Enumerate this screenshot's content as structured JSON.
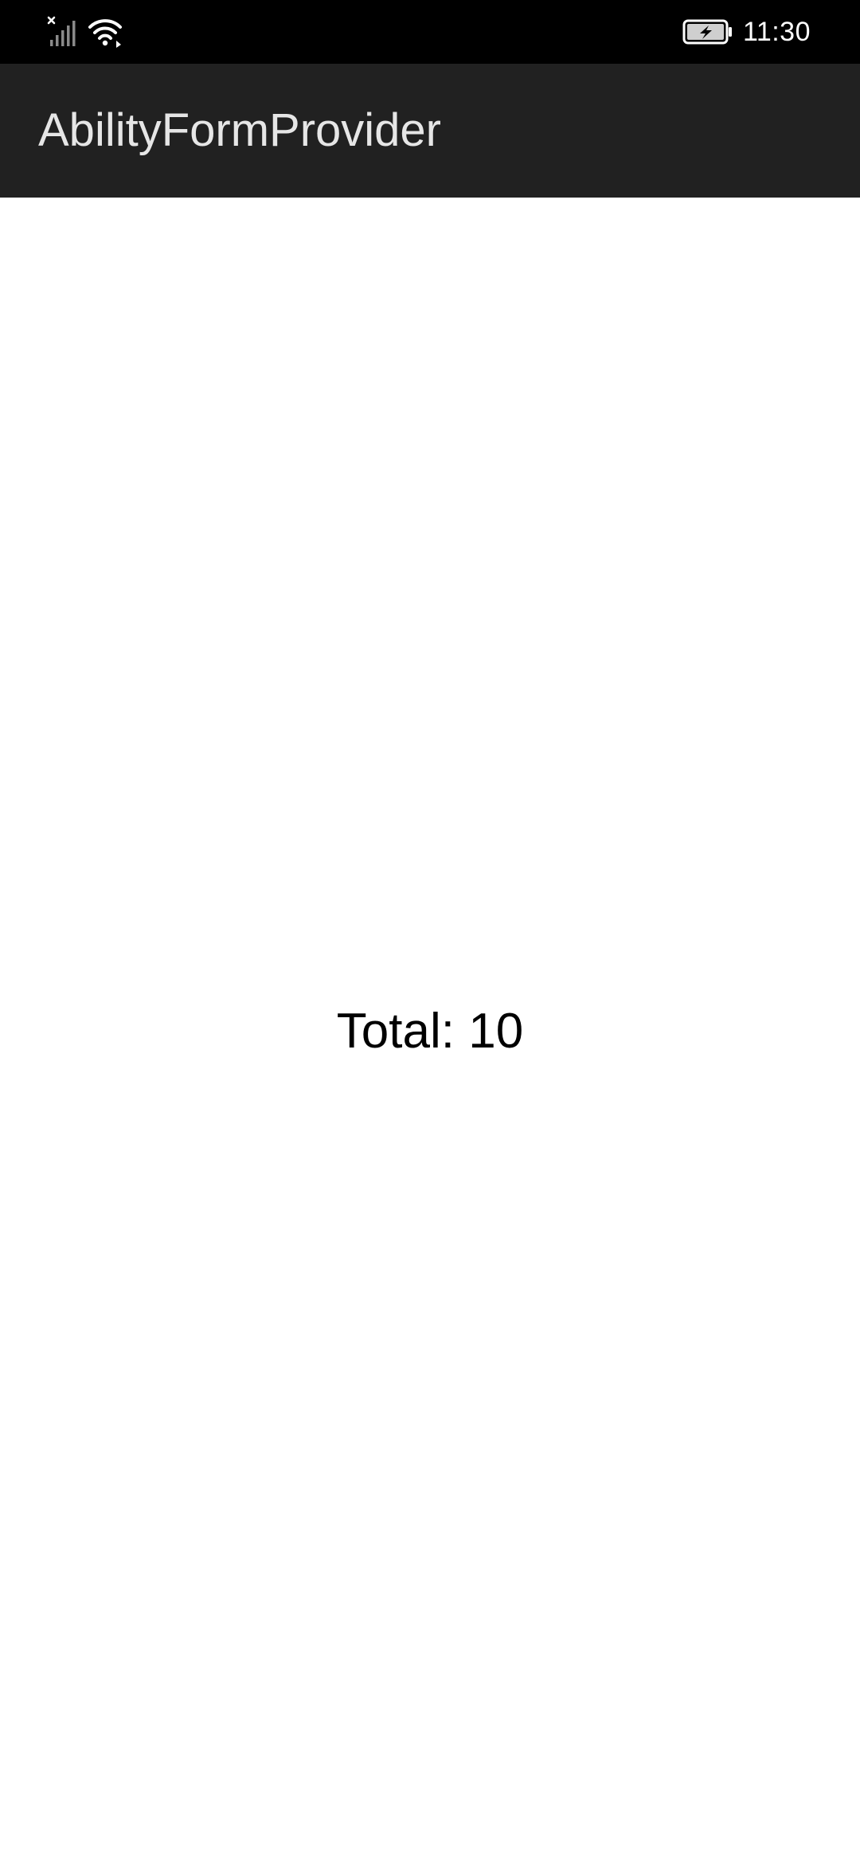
{
  "status_bar": {
    "time": "11:30",
    "icons": [
      "signal-no-service-icon",
      "wifi-icon",
      "battery-charging-icon"
    ]
  },
  "app_bar": {
    "title": "AbilityFormProvider"
  },
  "main": {
    "total_text": "Total: 10"
  },
  "colors": {
    "status_bar_bg": "#000000",
    "app_bar_bg": "#212121",
    "app_bar_text": "#e6e6e6",
    "content_bg": "#ffffff",
    "content_text": "#000000"
  }
}
